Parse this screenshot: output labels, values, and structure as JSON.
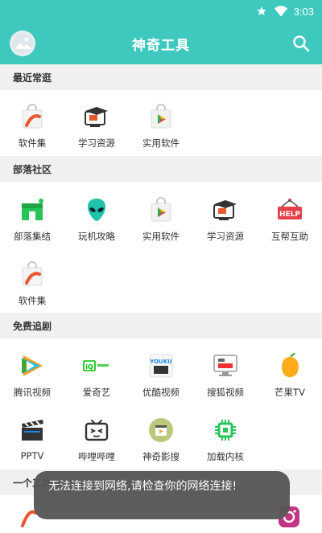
{
  "status_bar": {
    "time": "3:03",
    "icons": [
      "star-icon",
      "wifi-icon"
    ]
  },
  "app_bar": {
    "title": "神奇工具",
    "avatar_icon": "image-icon",
    "search_icon": "search-icon"
  },
  "sections": [
    {
      "title": "最近常逛",
      "items": [
        {
          "label": "软件集",
          "icon": "shopping-bag-icon"
        },
        {
          "label": "学习资源",
          "icon": "graduation-monitor-icon"
        },
        {
          "label": "实用软件",
          "icon": "play-store-bag-icon"
        }
      ]
    },
    {
      "title": "部落社区",
      "items": [
        {
          "label": "部落集结",
          "icon": "green-shop-icon"
        },
        {
          "label": "玩机攻略",
          "icon": "alien-icon"
        },
        {
          "label": "实用软件",
          "icon": "play-store-bag-icon"
        },
        {
          "label": "学习资源",
          "icon": "graduation-monitor-icon"
        },
        {
          "label": "互帮互助",
          "icon": "help-sign-icon"
        },
        {
          "label": "软件集",
          "icon": "shopping-bag-icon"
        }
      ]
    },
    {
      "title": "免费追剧",
      "items": [
        {
          "label": "腾讯视频",
          "icon": "tencent-video-icon"
        },
        {
          "label": "爱奇艺",
          "icon": "iqiyi-icon"
        },
        {
          "label": "优酷视频",
          "icon": "youku-icon"
        },
        {
          "label": "搜狐视频",
          "icon": "sohu-video-icon"
        },
        {
          "label": "芒果TV",
          "icon": "mango-icon"
        },
        {
          "label": "PPTV",
          "icon": "clapperboard-icon"
        },
        {
          "label": "哔哩哔哩",
          "icon": "bilibili-tv-icon"
        },
        {
          "label": "神奇影搜",
          "icon": "film-search-icon"
        },
        {
          "label": "加载内核",
          "icon": "chip-icon"
        }
      ]
    },
    {
      "title": "一个工具",
      "items": []
    }
  ],
  "toast": {
    "message": "无法连接到网络,请检查你的网络连接!"
  }
}
